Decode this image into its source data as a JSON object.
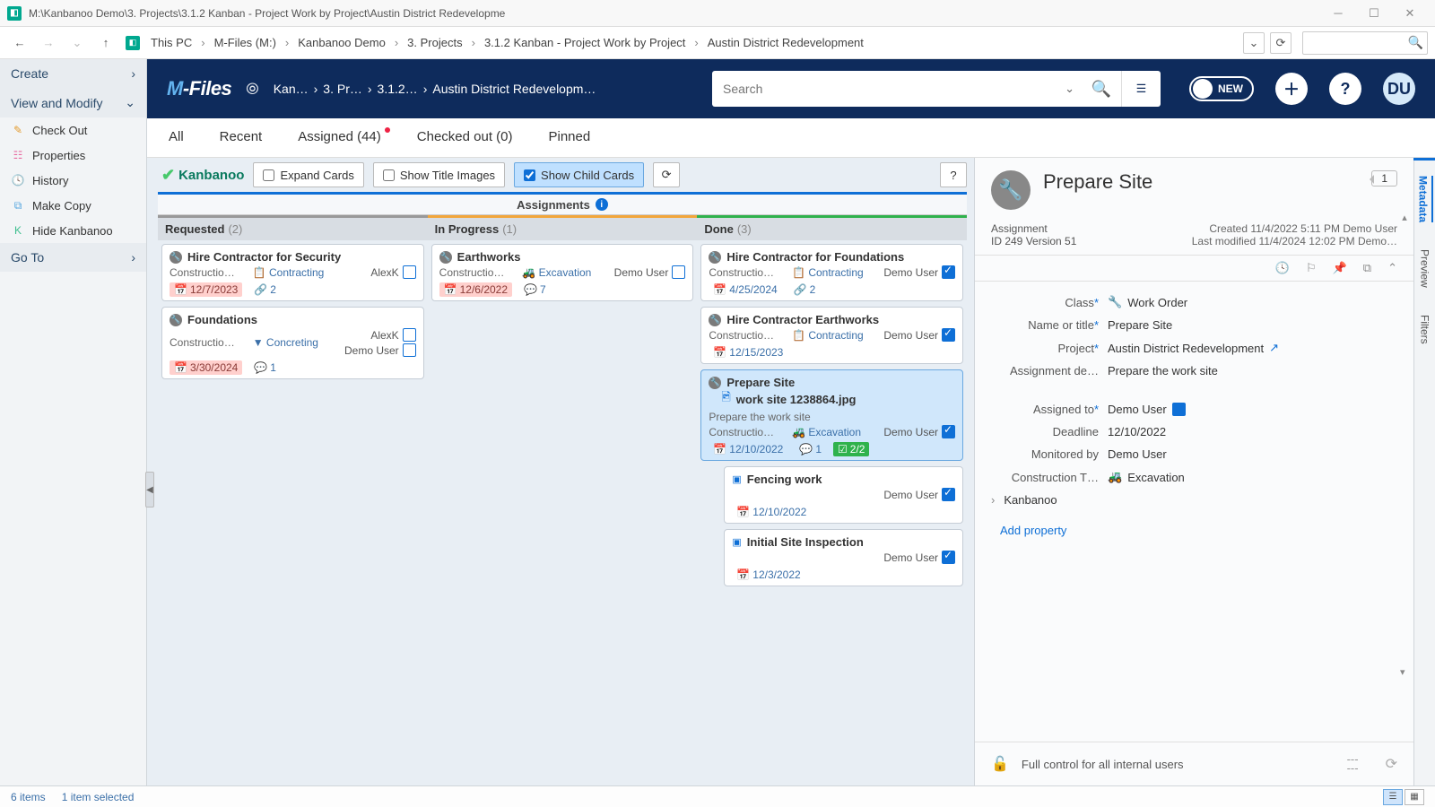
{
  "window": {
    "title": "M:\\Kanbanoo Demo\\3. Projects\\3.1.2 Kanban - Project Work by Project\\Austin District Redevelopme"
  },
  "address": {
    "crumbs": [
      "This PC",
      "M-Files (M:)",
      "Kanbanoo Demo",
      "3. Projects",
      "3.1.2 Kanban - Project Work by Project",
      "Austin District Redevelopment"
    ]
  },
  "leftnav": {
    "create": "Create",
    "viewmodify": "View and Modify",
    "items": [
      {
        "label": "Check Out",
        "iconColor": "#e39b2f"
      },
      {
        "label": "Properties",
        "iconColor": "#e86aa0"
      },
      {
        "label": "History",
        "iconColor": "#e0b94b"
      },
      {
        "label": "Make Copy",
        "iconColor": "#55a6e0"
      },
      {
        "label": "Hide Kanbanoo",
        "iconColor": "#3fbf8f"
      }
    ],
    "goto": "Go To"
  },
  "bluebar": {
    "search_placeholder": "Search",
    "new_label": "NEW",
    "avatar": "DU",
    "crumbs": [
      "Kan…",
      "3. Pr…",
      "3.1.2…",
      "Austin District Redevelopm…"
    ]
  },
  "tabs": {
    "all": "All",
    "recent": "Recent",
    "assigned": "Assigned (44)",
    "checked": "Checked out (0)",
    "pinned": "Pinned"
  },
  "ktoolbar": {
    "brand": "Kanbanoo",
    "expand": "Expand Cards",
    "showtitle": "Show Title Images",
    "showchild": "Show Child Cards"
  },
  "board": {
    "header": "Assignments",
    "lanes": {
      "requested": {
        "title": "Requested",
        "count": "(2)"
      },
      "inprogress": {
        "title": "In Progress",
        "count": "(1)"
      },
      "done": {
        "title": "Done",
        "count": "(3)"
      }
    }
  },
  "cards": {
    "req1": {
      "title": "Hire Contractor for Security",
      "cat": "Constructio…",
      "tag": "Contracting",
      "assignee": "AlexK",
      "date": "12/7/2023",
      "links": "2"
    },
    "req2": {
      "title": "Foundations",
      "cat": "Constructio…",
      "tag": "Concreting",
      "a1": "AlexK",
      "a2": "Demo User",
      "date": "3/30/2024",
      "comments": "1"
    },
    "prog1": {
      "title": "Earthworks",
      "cat": "Constructio…",
      "tag": "Excavation",
      "assignee": "Demo User",
      "date": "12/6/2022",
      "comments": "7"
    },
    "done1": {
      "title": "Hire Contractor for Foundations",
      "cat": "Constructio…",
      "tag": "Contracting",
      "assignee": "Demo User",
      "date": "4/25/2024",
      "links": "2"
    },
    "done2": {
      "title": "Hire Contractor Earthworks",
      "cat": "Constructio…",
      "tag": "Contracting",
      "assignee": "Demo User",
      "date": "12/15/2023"
    },
    "done3": {
      "title": "Prepare Site",
      "file": "work site 1238864.jpg",
      "desc": "Prepare the work site",
      "cat": "Constructio…",
      "tag": "Excavation",
      "assignee": "Demo User",
      "date": "12/10/2022",
      "comments": "1",
      "progress": "2/2"
    },
    "child1": {
      "title": "Fencing work",
      "assignee": "Demo User",
      "date": "12/10/2022"
    },
    "child2": {
      "title": "Initial Site Inspection",
      "assignee": "Demo User",
      "date": "12/3/2022"
    }
  },
  "details": {
    "title": "Prepare Site",
    "badge": "1",
    "type": "Assignment",
    "id": "ID 249  Version 51",
    "created": "Created 11/4/2022 5:11 PM Demo User",
    "modified": "Last modified 11/4/2024 12:02 PM Demo…",
    "fields": {
      "class_lbl": "Class",
      "class_val": "Work Order",
      "name_lbl": "Name or title",
      "name_val": "Prepare Site",
      "project_lbl": "Project",
      "project_val": "Austin District Redevelopment",
      "desc_lbl": "Assignment de…",
      "desc_val": "Prepare the work site",
      "assigned_lbl": "Assigned to",
      "assigned_val": "Demo User",
      "deadline_lbl": "Deadline",
      "deadline_val": "12/10/2022",
      "monitored_lbl": "Monitored by",
      "monitored_val": "Demo User",
      "ctype_lbl": "Construction T…",
      "ctype_val": "Excavation",
      "kan_lbl": "Kanbanoo"
    },
    "addprop": "Add property",
    "perm": "Full control for all internal users"
  },
  "sidetabs": {
    "metadata": "Metadata",
    "preview": "Preview",
    "filters": "Filters"
  },
  "status": {
    "items": "6 items",
    "selected": "1 item selected"
  }
}
